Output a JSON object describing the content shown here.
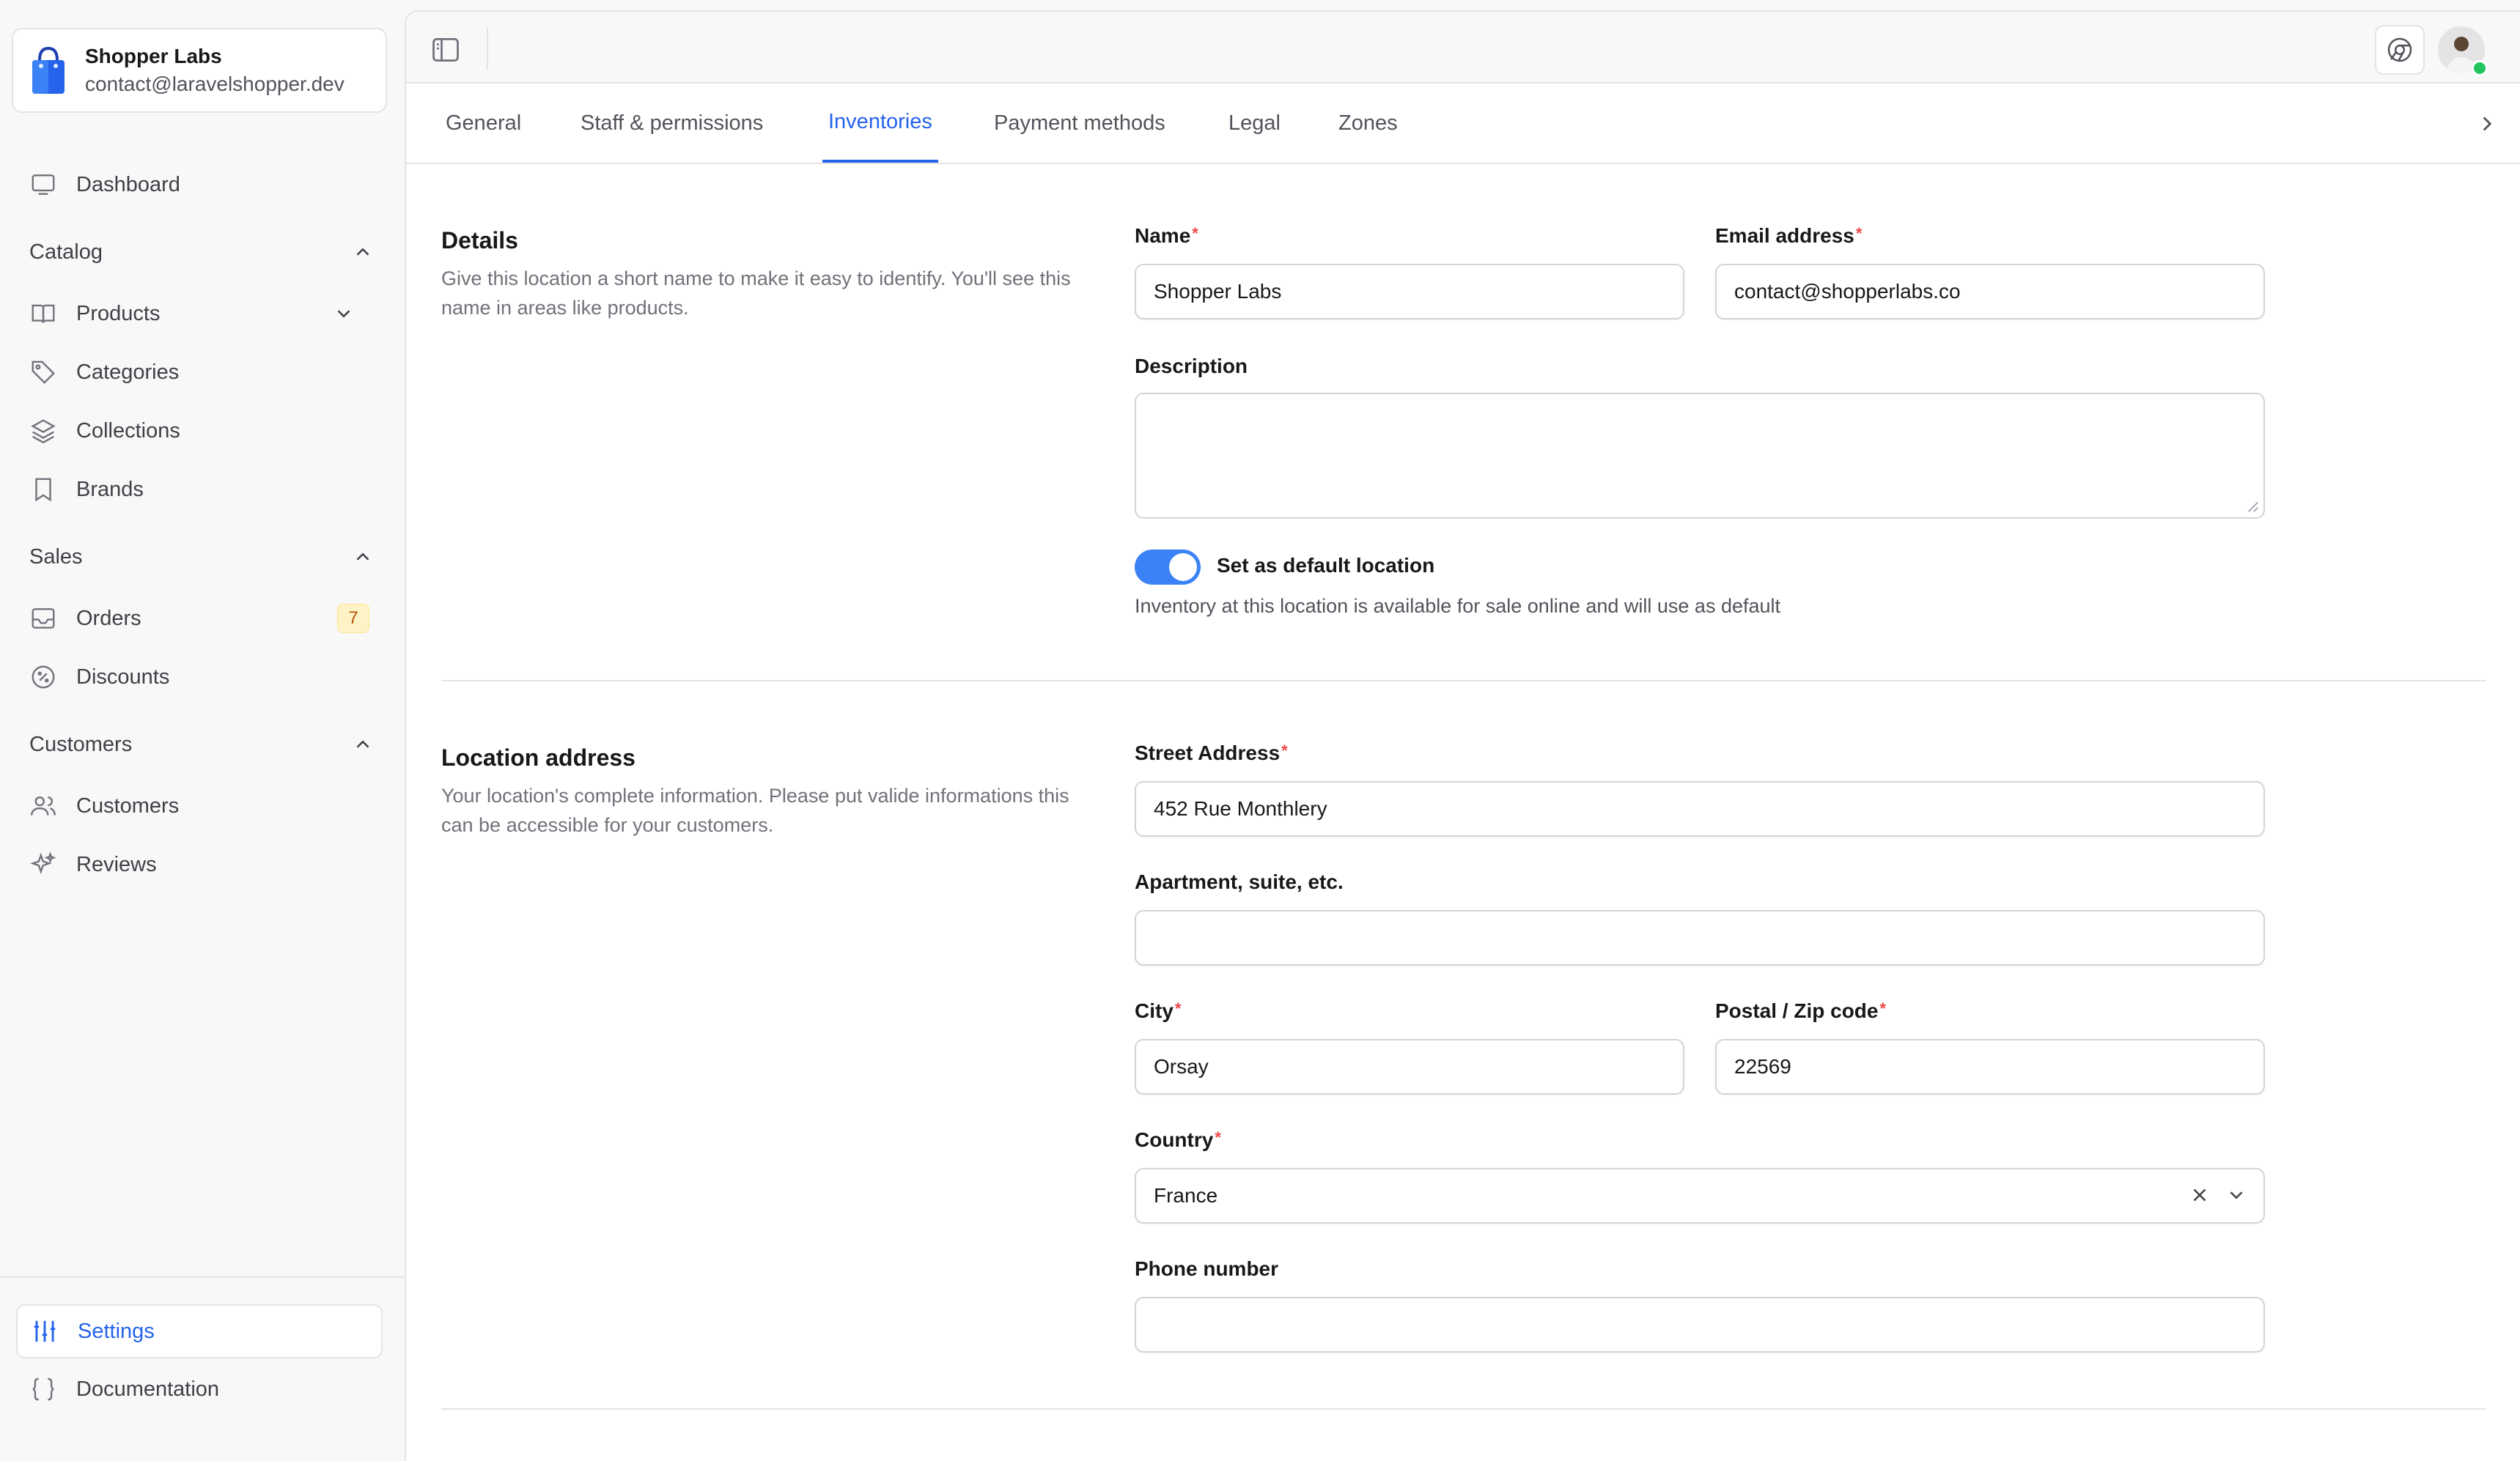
{
  "store": {
    "name": "Shopper Labs",
    "email": "contact@laravelshopper.dev"
  },
  "sidebar": {
    "dashboard": "Dashboard",
    "catalog": {
      "label": "Catalog",
      "items": [
        "Products",
        "Categories",
        "Collections",
        "Brands"
      ]
    },
    "sales": {
      "label": "Sales",
      "items": [
        "Orders",
        "Discounts"
      ],
      "orders_badge": "7"
    },
    "customers": {
      "label": "Customers",
      "items": [
        "Customers",
        "Reviews"
      ]
    },
    "settings": "Settings",
    "documentation": "Documentation"
  },
  "tabs": [
    "General",
    "Staff & permissions",
    "Inventories",
    "Payment methods",
    "Legal",
    "Zones"
  ],
  "active_tab": "Inventories",
  "details": {
    "title": "Details",
    "description": "Give this location a short name to make it easy to identify. You'll see this name in areas like products.",
    "name_label": "Name",
    "name_value": "Shopper Labs",
    "email_label": "Email address",
    "email_value": "contact@shopperlabs.co",
    "description_label": "Description",
    "description_value": "",
    "default_toggle_label": "Set as default location",
    "default_toggle_on": true,
    "default_toggle_help": "Inventory at this location is available for sale online and will use as default"
  },
  "address": {
    "title": "Location address",
    "description": "Your location's complete information. Please put valide informations this can be accessible for your customers.",
    "street_label": "Street Address",
    "street_value": "452 Rue Monthlery",
    "apartment_label": "Apartment, suite, etc.",
    "apartment_value": "",
    "city_label": "City",
    "city_value": "Orsay",
    "postal_label": "Postal / Zip code",
    "postal_value": "22569",
    "country_label": "Country",
    "country_value": "France",
    "phone_label": "Phone number",
    "phone_value": ""
  },
  "colors": {
    "accent": "#2563eb",
    "required": "#ef4444",
    "toggle_on": "#3b82f6",
    "badge_bg": "#fef3c7",
    "online": "#22c55e"
  }
}
